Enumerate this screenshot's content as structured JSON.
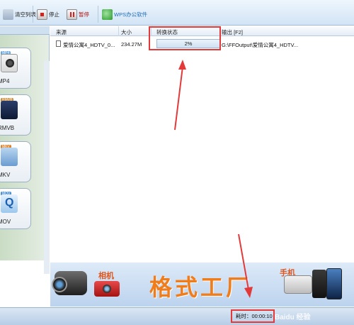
{
  "toolbar": {
    "clear_list": "清空列表",
    "stop": "停止",
    "pause": "暂停",
    "wps": "WPS办公软件"
  },
  "formats": [
    {
      "tag": "MP4",
      "label": "MP4"
    },
    {
      "tag": "RMVB",
      "label": "RMVB"
    },
    {
      "tag": "MKV",
      "label": "MKV"
    },
    {
      "tag": "MOV",
      "label": "MOV"
    }
  ],
  "table": {
    "columns": [
      "来源",
      "大小",
      "转换状态",
      "输出 [F2]"
    ],
    "rows": [
      {
        "source": "爱情公寓4_HDTV_0...",
        "size": "234.27M",
        "status": "2%",
        "output": "G:\\FFOutput\\爱情公寓4_HDTV..."
      }
    ],
    "progress_fraction": 0.02
  },
  "banner": {
    "title": "格式工厂",
    "camera_label": "相机",
    "phone_label": "手机"
  },
  "status": {
    "elapsed": "耗时：00:00:10"
  },
  "watermark": "Baidu 经验",
  "colors": {
    "highlight": "#e23a3a",
    "banner_title": "#f07d1a"
  }
}
